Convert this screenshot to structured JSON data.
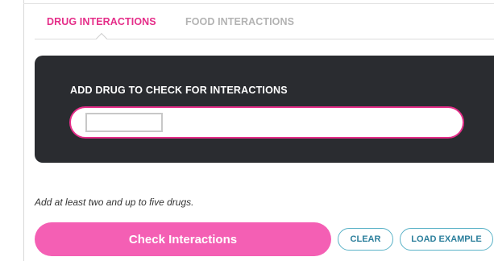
{
  "tabs": {
    "drug": "DRUG INTERACTIONS",
    "food": "FOOD INTERACTIONS"
  },
  "panel": {
    "label": "ADD DRUG TO CHECK FOR INTERACTIONS",
    "input_value": ""
  },
  "hint": "Add at least two and up to five drugs.",
  "actions": {
    "check": "Check Interactions",
    "clear": "CLEAR",
    "load_example": "LOAD EXAMPLE"
  },
  "colors": {
    "accent_pink": "#e52e89",
    "button_pink": "#f45fb4",
    "panel_dark": "#2a2c30",
    "pill_teal": "#5ab2c7"
  }
}
